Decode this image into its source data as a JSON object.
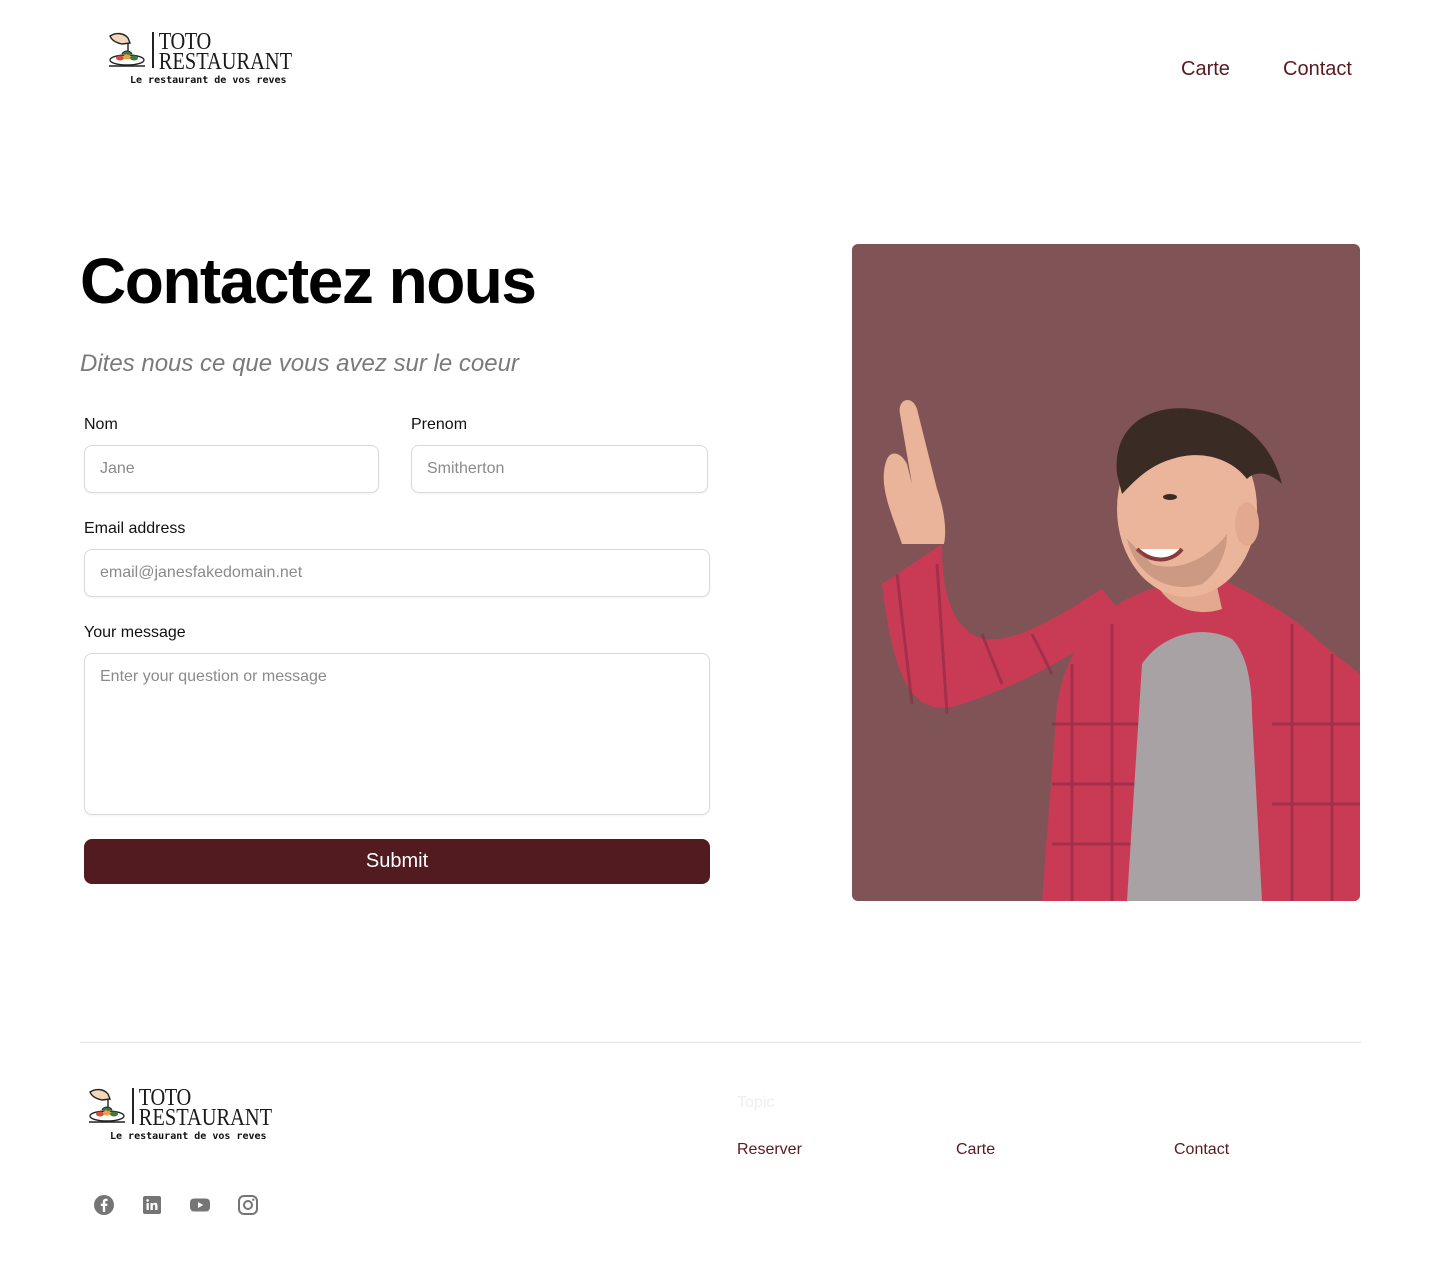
{
  "header": {
    "logo": {
      "brand_line1": "TOTO",
      "brand_line2": "RESTAURANT",
      "tagline": "Le restaurant de vos reves"
    },
    "nav": [
      {
        "label": "Carte"
      },
      {
        "label": "Contact"
      }
    ]
  },
  "hero": {
    "title": "Contactez nous",
    "subtitle": "Dites nous ce que vous avez sur le coeur"
  },
  "form": {
    "nom": {
      "label": "Nom",
      "placeholder": "Jane",
      "value": ""
    },
    "prenom": {
      "label": "Prenom",
      "placeholder": "Smitherton",
      "value": ""
    },
    "email": {
      "label": "Email address",
      "placeholder": "email@janesfakedomain.net",
      "value": ""
    },
    "message": {
      "label": "Your message",
      "placeholder": "Enter your question or message",
      "value": ""
    },
    "submit_label": "Submit"
  },
  "image": {
    "background_color": "#805456",
    "description_icon": "man-pointing-photo"
  },
  "footer": {
    "logo": {
      "brand_line1": "TOTO",
      "brand_line2": "RESTAURANT",
      "tagline": "Le restaurant de vos reves"
    },
    "topic_label": "Topic",
    "links": [
      {
        "label": "Reserver"
      },
      {
        "label": "Carte"
      },
      {
        "label": "Contact"
      }
    ],
    "social": [
      "facebook-icon",
      "linkedin-icon",
      "youtube-icon",
      "instagram-icon"
    ]
  },
  "colors": {
    "accent": "#511b1f",
    "nav_text": "#5a1a1f",
    "subtitle": "#7a7a7a",
    "photo_bg": "#805456"
  }
}
